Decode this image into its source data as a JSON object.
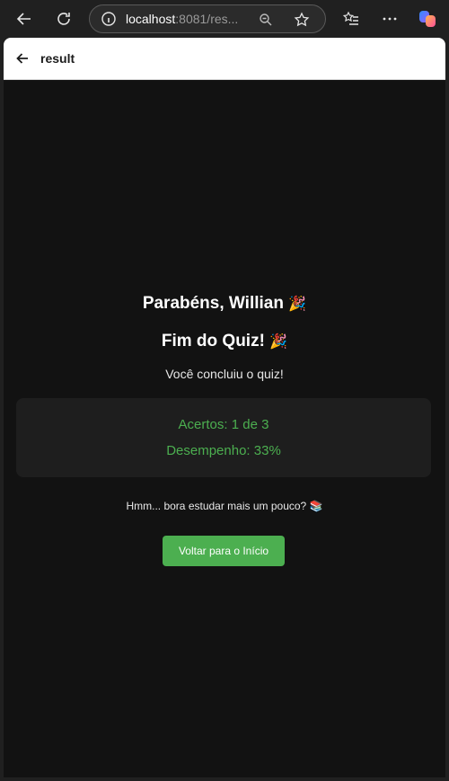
{
  "browser": {
    "url_host": "localhost",
    "url_rest": ":8081/res...",
    "icons": [
      "back-arrow-icon",
      "refresh-icon",
      "info-icon",
      "zoom-icon",
      "favorite-star-icon",
      "collections-icon",
      "more-icon",
      "copilot-icon"
    ]
  },
  "app": {
    "header_title": "result"
  },
  "result": {
    "congrats": "Parabéns, Willian",
    "congrats_emoji": "🎉",
    "quiz_end": "Fim do Quiz!",
    "quiz_end_emoji": "🎉",
    "subtitle": "Você concluiu o quiz!",
    "correct": "Acertos: 1 de 3",
    "performance": "Desempenho: 33%",
    "message": "Hmm... bora estudar mais um pouco?",
    "message_emoji": "📚",
    "home_button": "Voltar para o Início"
  },
  "colors": {
    "accent": "#4caf50",
    "background": "#121212",
    "card": "#1e1e1e"
  }
}
